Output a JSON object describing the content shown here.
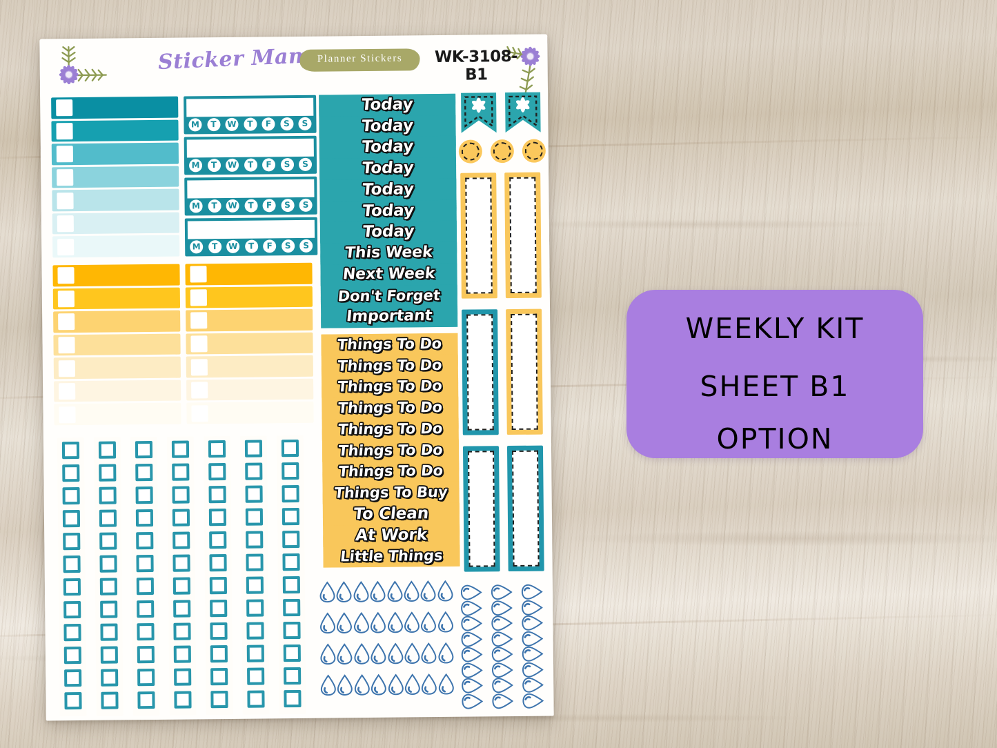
{
  "background": {
    "surface": "light-washed-wood",
    "color": "#d8cdbd"
  },
  "sheet": {
    "header": {
      "brand": "Sticker Mama",
      "badge": "Planner Stickers",
      "code": "WK-3108-B1",
      "badge_color": "#a8a868",
      "brand_color": "#9b7fd4",
      "flower_left": "purple-daisy-sprig-icon",
      "flower_right": "purple-daisy-sprig-icon"
    },
    "teal_checkbox_bars": {
      "label": "Teal gradient checkbox bars",
      "count": 7,
      "colors": [
        "#0a8fa3",
        "#16a0b0",
        "#52bccb",
        "#8bd3dd",
        "#b9e4ea",
        "#d9f0f3",
        "#eaf8f9"
      ],
      "checkbox_color": "#ffffff"
    },
    "weekday_trackers": {
      "label": "Weekly habit tracker boxes",
      "count": 4,
      "box_color": "#1b8fa0",
      "days": [
        "M",
        "T",
        "W",
        "T",
        "F",
        "S",
        "S"
      ]
    },
    "yellow_checkbox_bars_left": {
      "label": "Yellow gradient checkbox bars (left column)",
      "count": 7,
      "colors": [
        "#ffb703",
        "#ffc river",
        "#fdd371",
        "#fde09a",
        "#fdecc4",
        "#fef5e2",
        "#fffcf3"
      ]
    },
    "yellow_checkbox_bars_right": {
      "label": "Yellow gradient checkbox bars (right column)",
      "count": 7,
      "colors": [
        "#ffb703",
        "#ffc61e",
        "#fdd371",
        "#fde09a",
        "#fdecc4",
        "#fef5e2",
        "#fffcf3"
      ]
    },
    "teal_header_strips": {
      "background": "#2ba5ad",
      "items": [
        "Today",
        "Today",
        "Today",
        "Today",
        "Today",
        "Today",
        "Today",
        "This Week",
        "Next Week",
        "Don't Forget",
        "Important"
      ]
    },
    "yellow_header_strips": {
      "background": "#f9c75b",
      "items": [
        "Things To Do",
        "Things To Do",
        "Things To Do",
        "Things To Do",
        "Things To Do",
        "Things To Do",
        "Things To Do",
        "Things To Buy",
        "To Clean",
        "At Work",
        "Little Things"
      ]
    },
    "flag_banners": {
      "label": "Teal flag banner stickers with flower",
      "count": 2,
      "color": "#2ba5ad",
      "icon": "flower-icon",
      "dashed_border": "#20201e"
    },
    "circle_stickers": {
      "label": "Yellow dashed circle stickers",
      "count": 3,
      "color": "#fbc85c",
      "dashed_border": "#20201e"
    },
    "vertical_bars": {
      "label": "Vertical sidebar strip stickers",
      "rows": [
        {
          "colors": [
            "#f9c75b",
            "#f9c75b"
          ]
        },
        {
          "colors": [
            "#2196ab",
            "#f9c75b"
          ]
        },
        {
          "colors": [
            "#2196ab",
            "#2196ab"
          ]
        }
      ],
      "dashed_border": "#20201e"
    },
    "checkbox_grid": {
      "label": "Teal square checkbox grid",
      "columns": 7,
      "rows": 12,
      "color": "#2896ab"
    },
    "water_drops_vertical": {
      "label": "Water drop tracker stickers",
      "rows": 4,
      "per_row": 8,
      "color": "#3d74ad"
    },
    "water_drops_rotated": {
      "label": "Rotated water drop tracker stickers",
      "columns": 3,
      "per_column": 8,
      "color": "#3d74ad"
    }
  },
  "purple_label": {
    "line1": "WEEKLY KIT",
    "line2": "SHEET B1",
    "line3": "OPTION",
    "background": "#a97ee0",
    "text_color": "#000000"
  }
}
